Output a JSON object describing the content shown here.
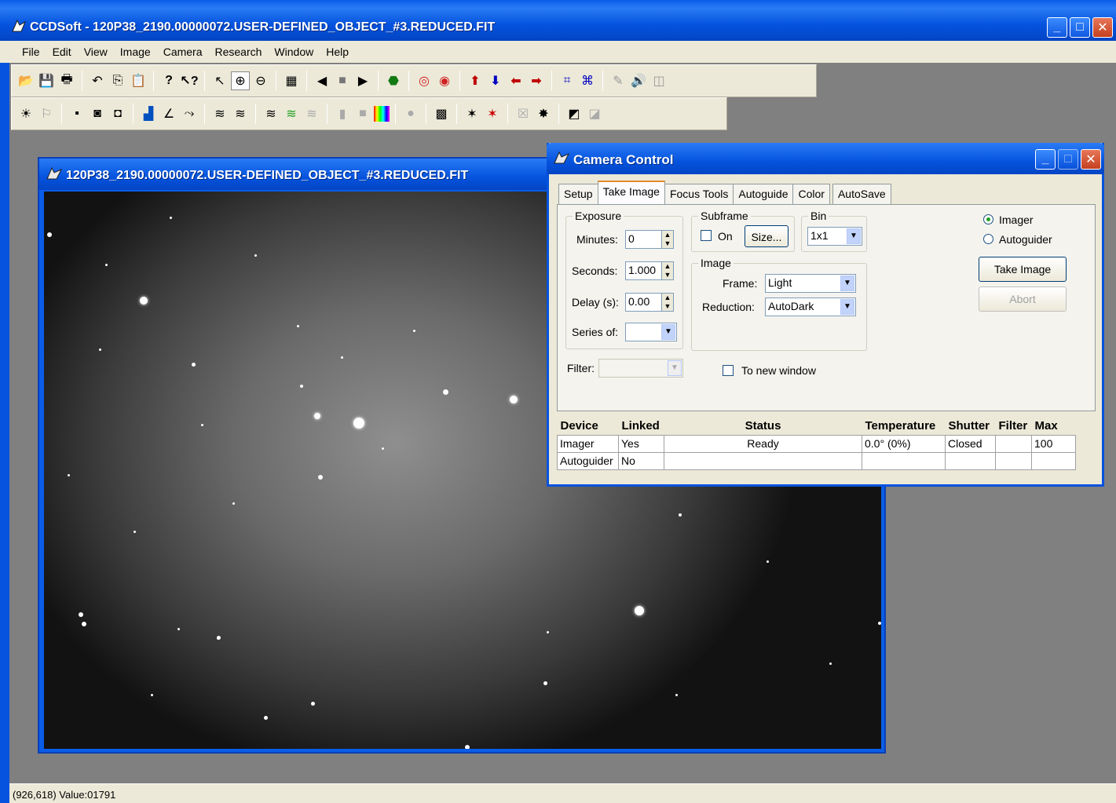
{
  "app": {
    "title": "CCDSoft  - 120P38_2190.00000072.USER-DEFINED_OBJECT_#3.REDUCED.FIT"
  },
  "menu": [
    "File",
    "Edit",
    "View",
    "Image",
    "Camera",
    "Research",
    "Window",
    "Help"
  ],
  "image_window": {
    "title": "120P38_2190.00000072.USER-DEFINED_OBJECT_#3.REDUCED.FIT"
  },
  "camera": {
    "title": "Camera Control",
    "tabs": [
      "Setup",
      "Take Image",
      "Focus Tools",
      "Autoguide",
      "Color",
      "AutoSave"
    ],
    "active_tab": "Take Image",
    "exposure": {
      "group": "Exposure",
      "minutes_label": "Minutes:",
      "minutes": "0",
      "seconds_label": "Seconds:",
      "seconds": "1.000",
      "delay_label": "Delay (s):",
      "delay": "0.00",
      "series_label": "Series of:",
      "series": ""
    },
    "subframe": {
      "group": "Subframe",
      "on_label": "On",
      "size_label": "Size..."
    },
    "bin": {
      "group": "Bin",
      "value": "1x1"
    },
    "image": {
      "group": "Image",
      "frame_label": "Frame:",
      "frame": "Light",
      "reduction_label": "Reduction:",
      "reduction": "AutoDark"
    },
    "filter_label": "Filter:",
    "new_window_label": "To new window",
    "imager_label": "Imager",
    "autoguider_label": "Autoguider",
    "take_image": "Take Image",
    "abort": "Abort",
    "table": {
      "headers": [
        "Device",
        "Linked",
        "Status",
        "Temperature",
        "Shutter",
        "Filter",
        "Max"
      ],
      "rows": [
        [
          "Imager",
          "Yes",
          "Ready",
          "0.0° (0%)",
          "Closed",
          "",
          "100"
        ],
        [
          "Autoguider",
          "No",
          "",
          "",
          "",
          "",
          ""
        ]
      ]
    }
  },
  "status": "(926,618) Value:01791"
}
